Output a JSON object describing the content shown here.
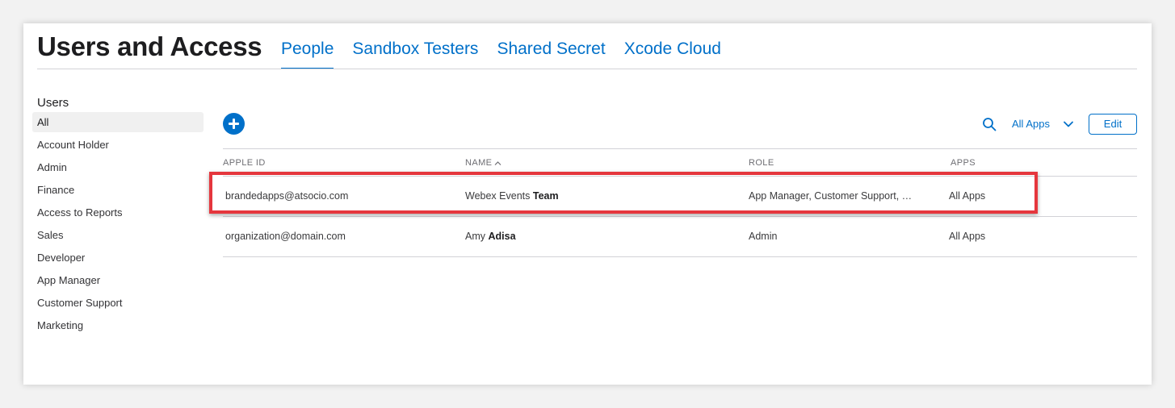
{
  "header": {
    "title": "Users and Access",
    "tabs": [
      {
        "label": "People",
        "active": true
      },
      {
        "label": "Sandbox Testers",
        "active": false
      },
      {
        "label": "Shared Secret",
        "active": false
      },
      {
        "label": "Xcode Cloud",
        "active": false
      }
    ]
  },
  "sidebar": {
    "title": "Users",
    "items": [
      {
        "label": "All",
        "selected": true
      },
      {
        "label": "Account Holder"
      },
      {
        "label": "Admin"
      },
      {
        "label": "Finance"
      },
      {
        "label": "Access to Reports"
      },
      {
        "label": "Sales"
      },
      {
        "label": "Developer"
      },
      {
        "label": "App Manager"
      },
      {
        "label": "Customer Support"
      },
      {
        "label": "Marketing"
      }
    ]
  },
  "toolbar": {
    "add_icon": "plus-circle-icon",
    "search_icon": "search-icon",
    "apps_filter_label": "All Apps",
    "chevron_icon": "chevron-down-icon",
    "edit_label": "Edit"
  },
  "table": {
    "columns": [
      "APPLE ID",
      "NAME",
      "ROLE",
      "APPS"
    ],
    "sort_icon": "sort-ascending-icon",
    "rows": [
      {
        "apple_id": "brandedapps@atsocio.com",
        "first_name": "Webex Events",
        "last_name": "Team",
        "role": "App Manager, Customer Support, …",
        "apps": "All Apps",
        "highlighted": true
      },
      {
        "apple_id": "organization@domain.com",
        "first_name": "Amy",
        "last_name": "Adisa",
        "role": "Admin",
        "apps": "All Apps",
        "highlighted": false
      }
    ]
  },
  "colors": {
    "accent": "#0070c9",
    "highlight": "#e5363d",
    "divider": "#d2d2d7"
  }
}
